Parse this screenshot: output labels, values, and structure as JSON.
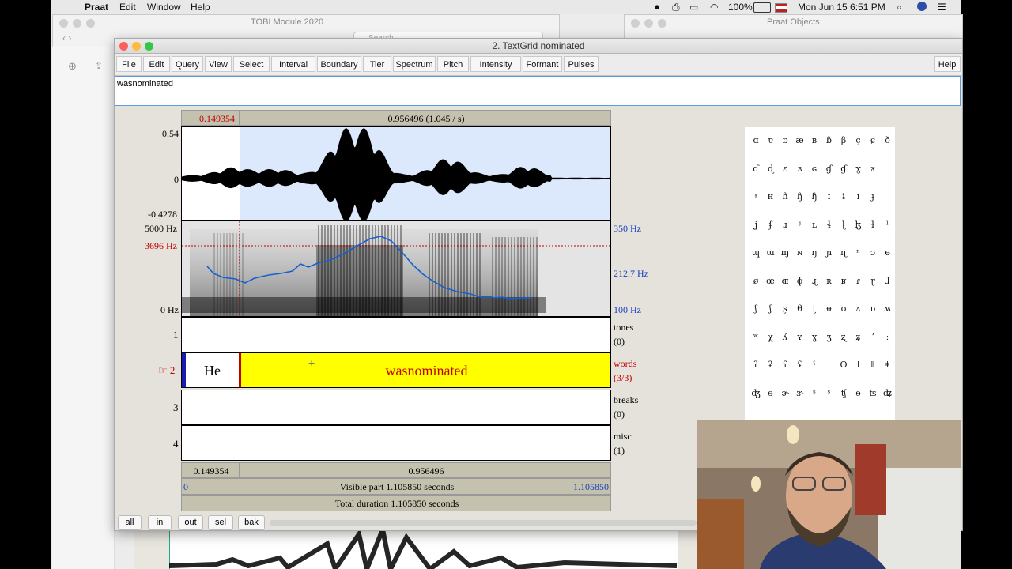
{
  "menubar": {
    "apple": "",
    "app": "Praat",
    "items": [
      "Edit",
      "Window",
      "Help"
    ],
    "battery": "100%",
    "datetime": "Mon Jun 15  6:51 PM"
  },
  "bg_windows": {
    "finder_title": "TOBI Module 2020",
    "finder_search": "Search",
    "objects_title": "Praat Objects"
  },
  "window": {
    "title": "2. TextGrid nominated",
    "menus": [
      "File",
      "Edit",
      "Query",
      "View",
      "Select",
      "Interval",
      "Boundary",
      "Tier",
      "Spectrum",
      "Pitch",
      "Intensity",
      "Formant",
      "Pulses"
    ],
    "help": "Help",
    "text_value": "wasnominated"
  },
  "editor": {
    "top_left_time": "0.149354",
    "top_sel": "0.956496 (1.045 / s)",
    "wave_max": "0.54",
    "wave_zero": "0",
    "wave_min": "-0.4278",
    "spec_top": "5000 Hz",
    "spec_cursor": "3696 Hz",
    "spec_bottom": "0 Hz",
    "pitch_top": "350 Hz",
    "pitch_mid": "212.7 Hz",
    "pitch_bottom": "100 Hz",
    "tiers": [
      {
        "num": "1",
        "name": "tones",
        "count": "(0)"
      },
      {
        "num": "2",
        "name": "words",
        "count": "(3/3)",
        "intervals": [
          "He",
          "wasnominated"
        ]
      },
      {
        "num": "3",
        "name": "breaks",
        "count": "(0)"
      },
      {
        "num": "4",
        "name": "misc",
        "count": "(1)"
      }
    ],
    "pointer": "☞",
    "bottom_left_time": "0.149354",
    "bottom_sel": "0.956496",
    "visible_start": "0",
    "visible_label": "Visible part 1.105850 seconds",
    "visible_end": "1.105850",
    "total_label": "Total duration 1.105850 seconds"
  },
  "bottom_buttons": [
    "all",
    "in",
    "out",
    "sel",
    "bak"
  ],
  "ipa_rows": [
    [
      "ɑ",
      "ɐ",
      "ɒ",
      "æ",
      "ʙ",
      "ɓ",
      "β",
      "ç",
      "ɕ",
      "ð"
    ],
    [
      "ɗ",
      "ɖ",
      "ɛ",
      "ɜ",
      "ɢ",
      "ɠ",
      "ɠ",
      "ɣ",
      "ɤ"
    ],
    [
      "ˠ",
      "ʜ",
      "ɦ",
      "ɧ",
      "ɧ",
      "ɪ",
      "ɨ",
      "ɪ",
      "ɟ"
    ],
    [
      "ʝ",
      "ʄ",
      "ɹ",
      "ʲ",
      "ʟ",
      "ɬ",
      "ɭ",
      "ɮ",
      "ɫ",
      "ˡ"
    ],
    [
      "ɰ",
      "ɯ",
      "ɱ",
      "ɴ",
      "ŋ",
      "ɲ",
      "ɳ",
      "ⁿ",
      "ɔ",
      "ɵ"
    ],
    [
      "ø",
      "œ",
      "ɶ",
      "ɸ",
      "ɻ",
      "ʀ",
      "ʁ",
      "ɾ",
      "ɽ",
      "ɺ"
    ],
    [
      "ʃ",
      "ʃ",
      "ʂ",
      "θ",
      "ʈ",
      "ʉ",
      "ʊ",
      "ʌ",
      "ʋ",
      "ʍ"
    ],
    [
      "ʷ",
      "χ",
      "ʎ",
      "ʏ",
      "ɣ",
      "ʒ",
      "ʐ",
      "ʑ",
      "ʼ",
      "ː"
    ],
    [
      "ʔ",
      "ʡ",
      "ʕ",
      "ʢ",
      "ˤ",
      "ǃ",
      "ʘ",
      "ǀ",
      "ǁ",
      "ǂ"
    ],
    [
      "ʤ",
      "ɘ",
      "ɚ",
      "ɝ",
      "ˢ",
      "ˢ",
      "ʧ",
      "ɘ",
      "ʦ",
      "ʥ"
    ]
  ],
  "colors": {
    "selection": "#dce8fb",
    "interval_selected": "#ffff00",
    "red": "#c00000",
    "blue": "#1a3fc2",
    "pitch_line": "#1560d0"
  }
}
